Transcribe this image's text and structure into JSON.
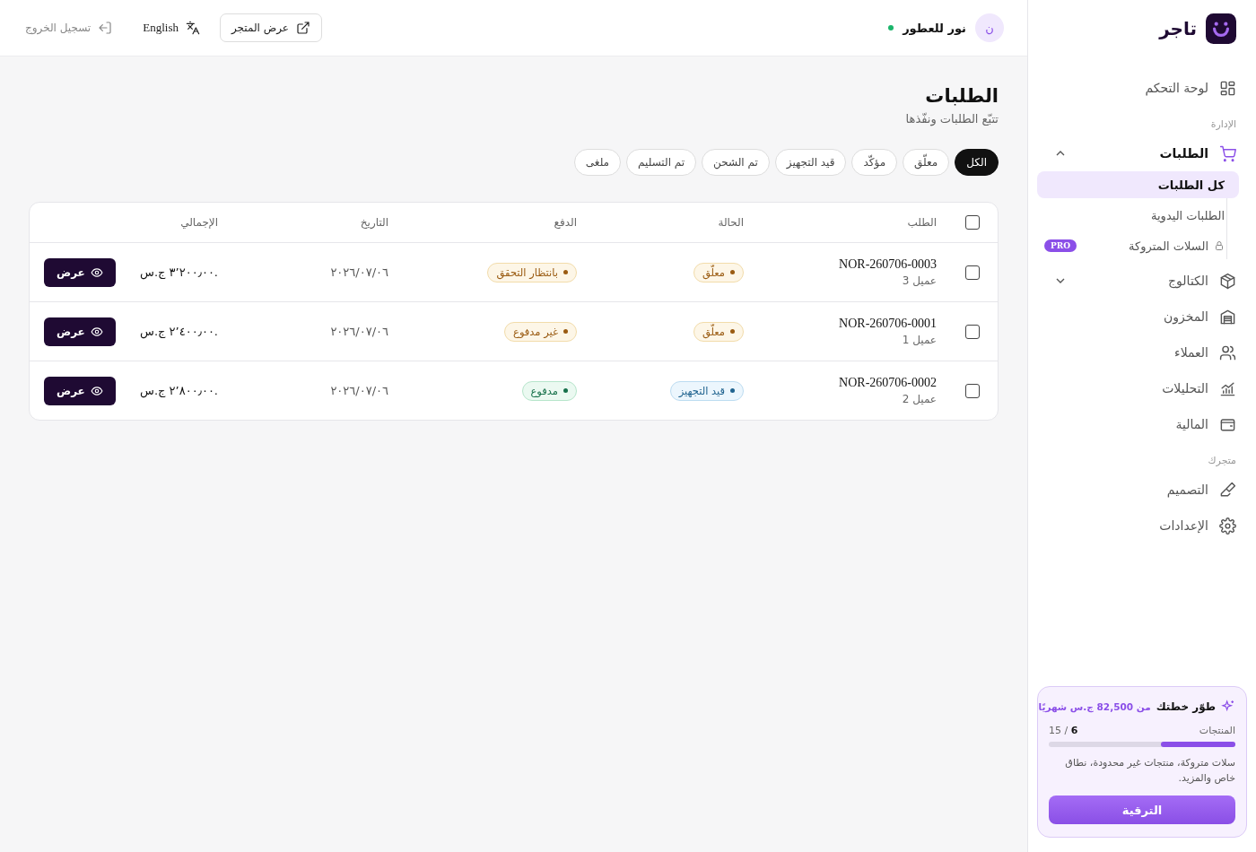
{
  "brand": {
    "name": "تاجر"
  },
  "sidebar": {
    "items": [
      {
        "kind": "link",
        "label": "لوحة التحكم",
        "selected": false
      },
      {
        "kind": "heading",
        "label": "الإدارة"
      },
      {
        "kind": "group",
        "label": "الطلبات",
        "expanded": true,
        "selected": true,
        "children": [
          {
            "label": "كل الطلبات",
            "selected": true,
            "locked": false
          },
          {
            "label": "الطلبات اليدوية",
            "selected": false,
            "locked": false
          },
          {
            "label": "السلات المتروكة",
            "selected": false,
            "locked": true,
            "badge": "PRO"
          }
        ]
      },
      {
        "kind": "group",
        "label": "الكتالوج",
        "expanded": false,
        "selected": false
      },
      {
        "kind": "link",
        "label": "المخزون",
        "selected": false
      },
      {
        "kind": "link",
        "label": "العملاء",
        "selected": false
      },
      {
        "kind": "link",
        "label": "التحليلات",
        "selected": false
      },
      {
        "kind": "link",
        "label": "المالية",
        "selected": false
      },
      {
        "kind": "heading",
        "label": "متجرك"
      },
      {
        "kind": "link",
        "label": "التصميم",
        "selected": false
      },
      {
        "kind": "link",
        "label": "الإعدادات",
        "selected": false
      }
    ]
  },
  "upgrade": {
    "title": "طوّر خطتك",
    "price": "من 82,500 ج.س شهريًا",
    "metric": "المنتجات",
    "used": "6",
    "limit": "/ 15",
    "level": 0.4,
    "text": "سلات متروكة، منتجات غير محدودة، نطاق خاص والمزيد.",
    "button": "الترقية"
  },
  "topbar": {
    "avatar": "ن",
    "store": "نور للعطور",
    "online": true,
    "view_store": "عرض المتجر",
    "language": "English",
    "logout": "تسجيل الخروج"
  },
  "page": {
    "title": "الطلبات",
    "subtitle": "تتبّع الطلبات ونفّذها"
  },
  "filters": [
    {
      "label": "الكل",
      "selected": true
    },
    {
      "label": "معلّق",
      "selected": false
    },
    {
      "label": "مؤكّد",
      "selected": false
    },
    {
      "label": "قيد التجهيز",
      "selected": false
    },
    {
      "label": "تم الشحن",
      "selected": false
    },
    {
      "label": "تم التسليم",
      "selected": false
    },
    {
      "label": "ملغى",
      "selected": false
    }
  ],
  "table": {
    "columns": [
      "الطلب",
      "الحالة",
      "الدفع",
      "التاريخ",
      "الإجمالي"
    ],
    "all_checked": false,
    "rows": [
      {
        "checked": false,
        "order": "NOR-260706-0003",
        "customer": "عميل 3",
        "status": {
          "label": "معلّق",
          "kind": "pending"
        },
        "payment": {
          "label": "بانتظار التحقق",
          "kind": "pending"
        },
        "date": "٢٠٢٦/٠٧/٠٦",
        "total": "٣٬٢٠٠٫٠٠ ج.س.",
        "action": "عرض"
      },
      {
        "checked": false,
        "order": "NOR-260706-0001",
        "customer": "عميل 1",
        "status": {
          "label": "معلّق",
          "kind": "pending"
        },
        "payment": {
          "label": "غير مدفوع",
          "kind": "pending"
        },
        "date": "٢٠٢٦/٠٧/٠٦",
        "total": "٢٬٤٠٠٫٠٠ ج.س.",
        "action": "عرض"
      },
      {
        "checked": false,
        "order": "NOR-260706-0002",
        "customer": "عميل 2",
        "status": {
          "label": "قيد التجهيز",
          "kind": "processing"
        },
        "payment": {
          "label": "مدفوع",
          "kind": "paid"
        },
        "date": "٢٠٢٦/٠٧/٠٦",
        "total": "٢٬٨٠٠٫٠٠ ج.س.",
        "action": "عرض"
      }
    ]
  }
}
